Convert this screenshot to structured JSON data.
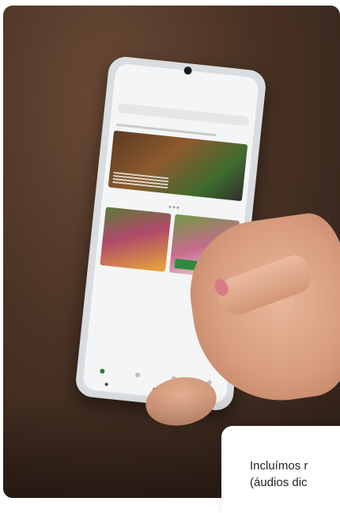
{
  "caption": {
    "line1": "Incluímos r",
    "line2": "(áudios dic"
  },
  "colors": {
    "accent": "#2e7d32",
    "background": "#4a3325",
    "card": "#ffffff",
    "text": "#222222"
  }
}
